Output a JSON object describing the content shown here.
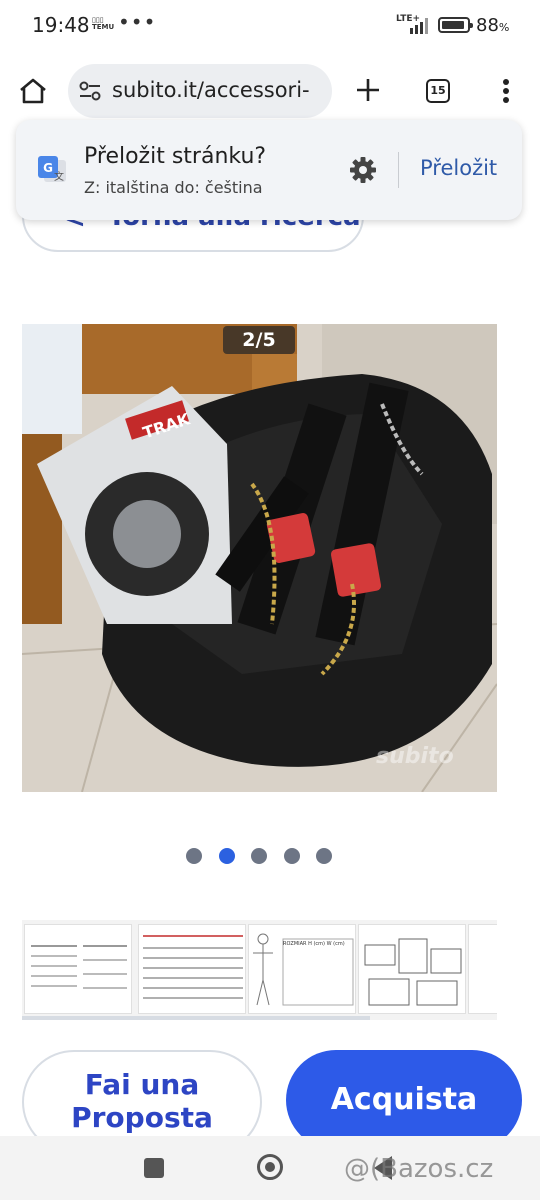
{
  "status_bar": {
    "time": "19:48",
    "temu_label": "TEMU",
    "notification_dots": "•••",
    "network": "LTE+",
    "battery_percent": "88",
    "battery_unit": "%"
  },
  "browser": {
    "url": "subito.it/accessori-",
    "tab_count": "15",
    "icons": [
      "home-icon",
      "site-settings-icon",
      "new-tab-plus-icon",
      "tab-switcher-icon",
      "overflow-menu-icon"
    ]
  },
  "translate_banner": {
    "title": "Přeložit stránku?",
    "subtitle": "Z: italština do: čeština",
    "translate_button": "Přeložit"
  },
  "page": {
    "back_link": "Torna alla ricerca",
    "image_counter": "2/5",
    "image_watermark": "subito",
    "carousel": {
      "total": 5,
      "active_index": 1
    },
    "thumbnail_table_headers": [
      "ROZMIAR",
      "H (cm)",
      "W (cm)"
    ],
    "offer_button": [
      "Fai una",
      "Proposta"
    ],
    "buy_button": "Acquista"
  },
  "overlay_watermark": "@(Bazos.cz",
  "colors": {
    "primary_blue": "#2d5ae8",
    "link_blue": "#2d45a8",
    "active_dot": "#2c61e0",
    "inactive_dot": "#6d7585"
  }
}
